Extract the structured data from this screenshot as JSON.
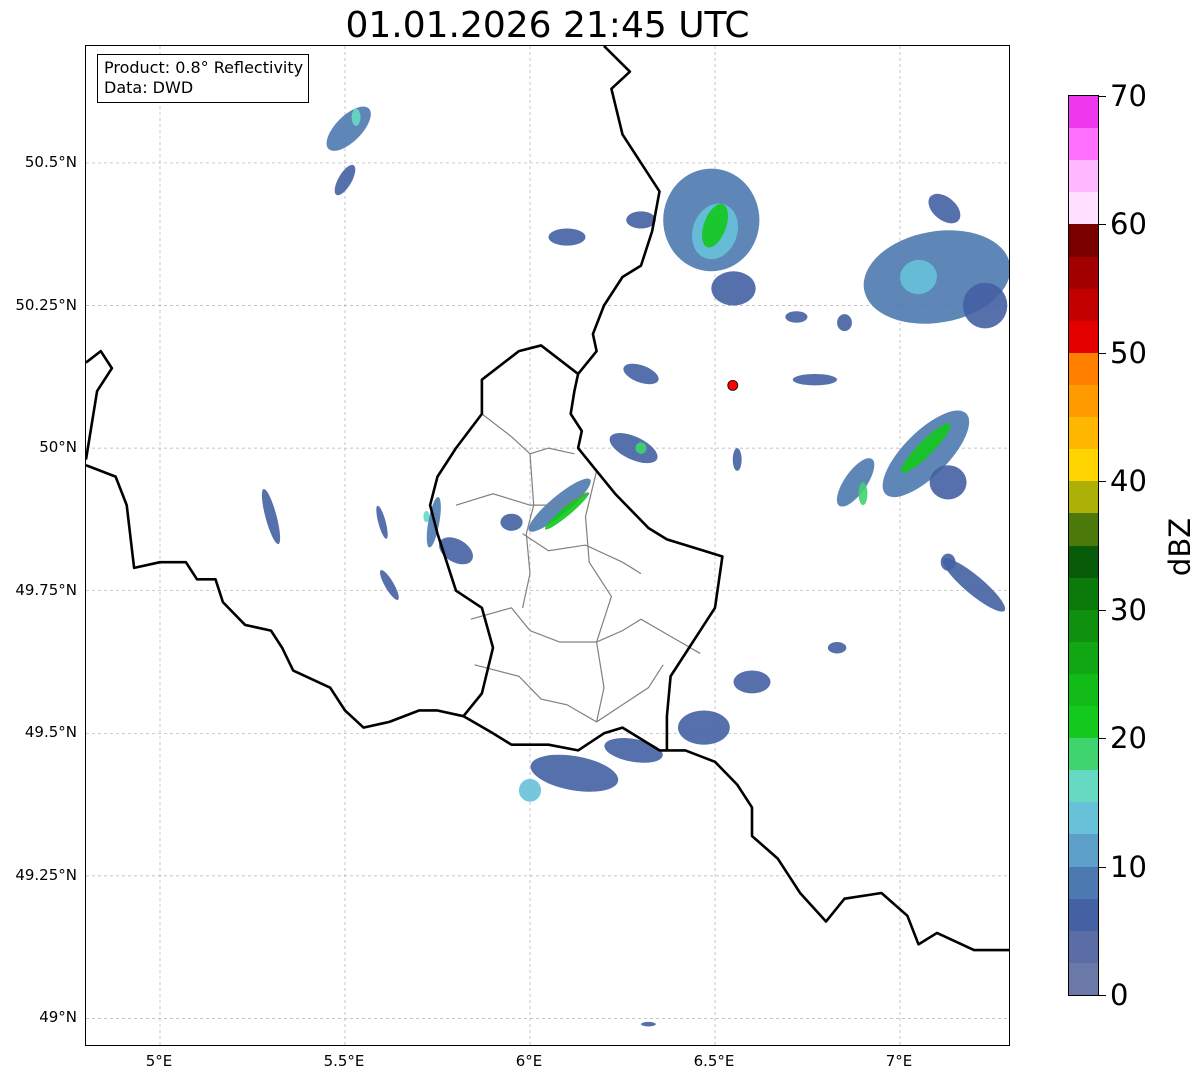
{
  "title": "01.01.2026 21:45 UTC",
  "info_box": {
    "product": "Product: 0.8° Reflectivity",
    "data_source": "Data: DWD"
  },
  "map": {
    "lon_range": [
      4.8,
      7.3
    ],
    "lat_range": [
      48.95,
      50.705
    ],
    "grid": true,
    "lat_ticks": [
      {
        "value": 50.5,
        "label": "50.5°N"
      },
      {
        "value": 50.25,
        "label": "50.25°N"
      },
      {
        "value": 50.0,
        "label": "50°N"
      },
      {
        "value": 49.75,
        "label": "49.75°N"
      },
      {
        "value": 49.5,
        "label": "49.5°N"
      },
      {
        "value": 49.25,
        "label": "49.25°N"
      },
      {
        "value": 49.0,
        "label": "49°N"
      }
    ],
    "lon_ticks": [
      {
        "value": 5.0,
        "label": "5°E"
      },
      {
        "value": 5.5,
        "label": "5.5°E"
      },
      {
        "value": 6.0,
        "label": "6°E"
      },
      {
        "value": 6.5,
        "label": "6.5°E"
      },
      {
        "value": 7.0,
        "label": "7°E"
      }
    ],
    "radar_site": {
      "lon": 6.548,
      "lat": 50.11,
      "color": "#ff0000"
    },
    "borders": [
      [
        [
          4.8,
          49.97
        ],
        [
          4.88,
          49.95
        ],
        [
          4.91,
          49.9
        ],
        [
          4.93,
          49.79
        ],
        [
          5.0,
          49.8
        ],
        [
          5.07,
          49.8
        ],
        [
          5.1,
          49.77
        ],
        [
          5.15,
          49.77
        ],
        [
          5.17,
          49.73
        ],
        [
          5.23,
          49.69
        ],
        [
          5.3,
          49.68
        ],
        [
          5.33,
          49.65
        ],
        [
          5.36,
          49.61
        ],
        [
          5.46,
          49.58
        ],
        [
          5.5,
          49.54
        ],
        [
          5.55,
          49.51
        ],
        [
          5.62,
          49.52
        ],
        [
          5.7,
          49.54
        ],
        [
          5.75,
          49.54
        ],
        [
          5.82,
          49.53
        ],
        [
          5.9,
          49.5
        ],
        [
          5.95,
          49.48
        ],
        [
          6.05,
          49.48
        ],
        [
          6.13,
          49.47
        ],
        [
          6.2,
          49.5
        ],
        [
          6.25,
          49.51
        ],
        [
          6.35,
          49.47
        ],
        [
          6.42,
          49.47
        ],
        [
          6.5,
          49.45
        ],
        [
          6.56,
          49.41
        ],
        [
          6.6,
          49.37
        ],
        [
          6.6,
          49.32
        ],
        [
          6.67,
          49.28
        ],
        [
          6.73,
          49.22
        ],
        [
          6.8,
          49.17
        ],
        [
          6.85,
          49.21
        ],
        [
          6.95,
          49.22
        ],
        [
          7.02,
          49.18
        ],
        [
          7.05,
          49.13
        ],
        [
          7.1,
          49.15
        ],
        [
          7.2,
          49.12
        ],
        [
          7.3,
          49.12
        ]
      ],
      [
        [
          4.8,
          50.15
        ],
        [
          4.84,
          50.17
        ],
        [
          4.87,
          50.14
        ],
        [
          4.83,
          50.1
        ],
        [
          4.8,
          49.98
        ]
      ],
      [
        [
          6.13,
          50.13
        ],
        [
          6.03,
          50.18
        ],
        [
          5.97,
          50.17
        ],
        [
          5.87,
          50.12
        ],
        [
          5.87,
          50.06
        ],
        [
          5.8,
          50.0
        ],
        [
          5.75,
          49.95
        ],
        [
          5.73,
          49.9
        ],
        [
          5.75,
          49.85
        ],
        [
          5.8,
          49.75
        ],
        [
          5.87,
          49.72
        ],
        [
          5.9,
          49.65
        ],
        [
          5.87,
          49.57
        ],
        [
          5.82,
          49.53
        ]
      ],
      [
        [
          6.13,
          50.13
        ],
        [
          6.12,
          50.1
        ],
        [
          6.11,
          50.06
        ],
        [
          6.14,
          50.03
        ],
        [
          6.13,
          50.0
        ],
        [
          6.18,
          49.96
        ],
        [
          6.23,
          49.92
        ],
        [
          6.32,
          49.86
        ],
        [
          6.37,
          49.84
        ],
        [
          6.47,
          49.82
        ],
        [
          6.52,
          49.81
        ],
        [
          6.5,
          49.72
        ],
        [
          6.43,
          49.65
        ],
        [
          6.38,
          49.6
        ],
        [
          6.37,
          49.53
        ],
        [
          6.37,
          49.47
        ]
      ],
      [
        [
          6.13,
          50.13
        ],
        [
          6.18,
          50.17
        ],
        [
          6.17,
          50.2
        ],
        [
          6.2,
          50.25
        ],
        [
          6.25,
          50.3
        ],
        [
          6.3,
          50.32
        ],
        [
          6.33,
          50.38
        ],
        [
          6.35,
          50.45
        ],
        [
          6.3,
          50.5
        ],
        [
          6.25,
          50.55
        ],
        [
          6.22,
          50.63
        ],
        [
          6.27,
          50.66
        ],
        [
          6.2,
          50.705
        ]
      ]
    ],
    "internal_borders": [
      [
        [
          5.87,
          50.06
        ],
        [
          5.95,
          50.02
        ],
        [
          6.0,
          49.99
        ],
        [
          6.05,
          50.0
        ],
        [
          6.12,
          49.99
        ]
      ],
      [
        [
          5.8,
          49.9
        ],
        [
          5.9,
          49.92
        ],
        [
          6.0,
          49.9
        ],
        [
          6.08,
          49.9
        ],
        [
          6.16,
          49.92
        ]
      ],
      [
        [
          5.98,
          49.85
        ],
        [
          6.05,
          49.82
        ],
        [
          6.15,
          49.83
        ],
        [
          6.25,
          49.8
        ],
        [
          6.3,
          49.78
        ]
      ],
      [
        [
          5.84,
          49.7
        ],
        [
          5.95,
          49.72
        ],
        [
          6.0,
          49.68
        ],
        [
          6.08,
          49.66
        ],
        [
          6.18,
          49.66
        ],
        [
          6.25,
          49.68
        ],
        [
          6.3,
          49.7
        ],
        [
          6.38,
          49.67
        ],
        [
          6.46,
          49.64
        ]
      ],
      [
        [
          5.85,
          49.62
        ],
        [
          5.97,
          49.6
        ],
        [
          6.03,
          49.56
        ],
        [
          6.1,
          49.55
        ],
        [
          6.18,
          49.52
        ],
        [
          6.25,
          49.55
        ],
        [
          6.32,
          49.58
        ],
        [
          6.36,
          49.62
        ]
      ],
      [
        [
          6.0,
          49.99
        ],
        [
          6.01,
          49.9
        ],
        [
          5.99,
          49.85
        ],
        [
          6.0,
          49.78
        ],
        [
          5.98,
          49.72
        ]
      ],
      [
        [
          6.18,
          49.96
        ],
        [
          6.15,
          49.88
        ],
        [
          6.16,
          49.8
        ],
        [
          6.22,
          49.74
        ],
        [
          6.18,
          49.66
        ],
        [
          6.2,
          49.58
        ],
        [
          6.18,
          49.52
        ]
      ]
    ],
    "echo_cells": [
      {
        "lon": 5.51,
        "lat": 50.56,
        "rx": 0.035,
        "ry": 0.05,
        "rot": 45,
        "dbz": 8
      },
      {
        "lon": 5.53,
        "lat": 50.58,
        "rx": 0.012,
        "ry": 0.015,
        "rot": 0,
        "dbz": 16
      },
      {
        "lon": 5.5,
        "lat": 50.47,
        "rx": 0.018,
        "ry": 0.03,
        "rot": 30,
        "dbz": 6
      },
      {
        "lon": 6.49,
        "lat": 50.4,
        "rx": 0.13,
        "ry": 0.09,
        "rot": 0,
        "dbz": 8
      },
      {
        "lon": 6.5,
        "lat": 50.38,
        "rx": 0.06,
        "ry": 0.05,
        "rot": 20,
        "dbz": 14
      },
      {
        "lon": 6.5,
        "lat": 50.39,
        "rx": 0.03,
        "ry": 0.04,
        "rot": 20,
        "dbz": 22
      },
      {
        "lon": 6.55,
        "lat": 50.28,
        "rx": 0.06,
        "ry": 0.03,
        "rot": 0,
        "dbz": 7
      },
      {
        "lon": 6.3,
        "lat": 50.4,
        "rx": 0.04,
        "ry": 0.015,
        "rot": 0,
        "dbz": 5
      },
      {
        "lon": 6.1,
        "lat": 50.37,
        "rx": 0.05,
        "ry": 0.015,
        "rot": 0,
        "dbz": 5
      },
      {
        "lon": 7.1,
        "lat": 50.3,
        "rx": 0.2,
        "ry": 0.08,
        "rot": -10,
        "dbz": 8
      },
      {
        "lon": 7.05,
        "lat": 50.3,
        "rx": 0.05,
        "ry": 0.03,
        "rot": -10,
        "dbz": 13
      },
      {
        "lon": 7.23,
        "lat": 50.25,
        "rx": 0.06,
        "ry": 0.04,
        "rot": 0,
        "dbz": 7
      },
      {
        "lon": 7.12,
        "lat": 50.42,
        "rx": 0.05,
        "ry": 0.02,
        "rot": 40,
        "dbz": 7
      },
      {
        "lon": 7.07,
        "lat": 49.99,
        "rx": 0.06,
        "ry": 0.1,
        "rot": 45,
        "dbz": 8
      },
      {
        "lon": 7.07,
        "lat": 50.0,
        "rx": 0.02,
        "ry": 0.06,
        "rot": 45,
        "dbz": 22
      },
      {
        "lon": 7.13,
        "lat": 49.94,
        "rx": 0.05,
        "ry": 0.03,
        "rot": 0,
        "dbz": 6
      },
      {
        "lon": 6.88,
        "lat": 49.94,
        "rx": 0.03,
        "ry": 0.05,
        "rot": 35,
        "dbz": 8
      },
      {
        "lon": 6.9,
        "lat": 49.92,
        "rx": 0.012,
        "ry": 0.02,
        "rot": 0,
        "dbz": 18
      },
      {
        "lon": 7.2,
        "lat": 49.76,
        "rx": 0.025,
        "ry": 0.07,
        "rot": -50,
        "dbz": 7
      },
      {
        "lon": 7.13,
        "lat": 49.8,
        "rx": 0.02,
        "ry": 0.015,
        "rot": 0,
        "dbz": 7
      },
      {
        "lon": 6.08,
        "lat": 49.9,
        "rx": 0.025,
        "ry": 0.07,
        "rot": 50,
        "dbz": 8
      },
      {
        "lon": 6.1,
        "lat": 49.89,
        "rx": 0.012,
        "ry": 0.05,
        "rot": 50,
        "dbz": 22
      },
      {
        "lon": 5.95,
        "lat": 49.87,
        "rx": 0.03,
        "ry": 0.015,
        "rot": 0,
        "dbz": 6
      },
      {
        "lon": 6.28,
        "lat": 50.0,
        "rx": 0.07,
        "ry": 0.02,
        "rot": 25,
        "dbz": 7
      },
      {
        "lon": 6.3,
        "lat": 50.0,
        "rx": 0.015,
        "ry": 0.01,
        "rot": 0,
        "dbz": 18
      },
      {
        "lon": 6.3,
        "lat": 50.13,
        "rx": 0.05,
        "ry": 0.015,
        "rot": 20,
        "dbz": 5
      },
      {
        "lon": 5.8,
        "lat": 49.82,
        "rx": 0.05,
        "ry": 0.02,
        "rot": 30,
        "dbz": 7
      },
      {
        "lon": 5.74,
        "lat": 49.87,
        "rx": 0.015,
        "ry": 0.045,
        "rot": 10,
        "dbz": 8
      },
      {
        "lon": 5.72,
        "lat": 49.88,
        "rx": 0.008,
        "ry": 0.01,
        "rot": 0,
        "dbz": 15
      },
      {
        "lon": 5.3,
        "lat": 49.88,
        "rx": 0.015,
        "ry": 0.05,
        "rot": -15,
        "dbz": 7
      },
      {
        "lon": 5.6,
        "lat": 49.87,
        "rx": 0.01,
        "ry": 0.03,
        "rot": -15,
        "dbz": 6
      },
      {
        "lon": 5.62,
        "lat": 49.76,
        "rx": 0.012,
        "ry": 0.03,
        "rot": -30,
        "dbz": 6
      },
      {
        "lon": 6.12,
        "lat": 49.43,
        "rx": 0.12,
        "ry": 0.03,
        "rot": 10,
        "dbz": 7
      },
      {
        "lon": 6.0,
        "lat": 49.4,
        "rx": 0.03,
        "ry": 0.02,
        "rot": 0,
        "dbz": 14
      },
      {
        "lon": 6.28,
        "lat": 49.47,
        "rx": 0.08,
        "ry": 0.02,
        "rot": 10,
        "dbz": 7
      },
      {
        "lon": 6.47,
        "lat": 49.51,
        "rx": 0.07,
        "ry": 0.03,
        "rot": 0,
        "dbz": 6
      },
      {
        "lon": 6.6,
        "lat": 49.59,
        "rx": 0.05,
        "ry": 0.02,
        "rot": 0,
        "dbz": 6
      },
      {
        "lon": 6.83,
        "lat": 49.65,
        "rx": 0.025,
        "ry": 0.01,
        "rot": 0,
        "dbz": 6
      },
      {
        "lon": 6.72,
        "lat": 50.23,
        "rx": 0.03,
        "ry": 0.01,
        "rot": 0,
        "dbz": 5
      },
      {
        "lon": 6.85,
        "lat": 50.22,
        "rx": 0.02,
        "ry": 0.015,
        "rot": 0,
        "dbz": 5
      },
      {
        "lon": 6.56,
        "lat": 49.98,
        "rx": 0.012,
        "ry": 0.02,
        "rot": 0,
        "dbz": 5
      },
      {
        "lon": 6.77,
        "lat": 50.12,
        "rx": 0.06,
        "ry": 0.01,
        "rot": 0,
        "dbz": 5
      },
      {
        "lon": 6.32,
        "lat": 48.99,
        "rx": 0.02,
        "ry": 0.004,
        "rot": 0,
        "dbz": 5
      }
    ]
  },
  "colorbar": {
    "label": "dBZ",
    "min": 0,
    "max": 70,
    "step": 2.5,
    "tick_labels": [
      "0",
      "10",
      "20",
      "30",
      "40",
      "50",
      "60",
      "70"
    ],
    "colors": [
      "#6a79a8",
      "#5b6da5",
      "#4461a3",
      "#4c7ab0",
      "#5c9fc9",
      "#67c1d9",
      "#65d9c2",
      "#3fd46e",
      "#12c91c",
      "#12bb17",
      "#11a613",
      "#0f900f",
      "#0a7a0b",
      "#085b09",
      "#4b790a",
      "#acb007",
      "#ffd400",
      "#ffb600",
      "#ff9b00",
      "#ff8000",
      "#e50000",
      "#c20000",
      "#a20000",
      "#7a0000",
      "#ffe0ff",
      "#ffb8ff",
      "#ff70ff",
      "#ee38ee"
    ]
  }
}
